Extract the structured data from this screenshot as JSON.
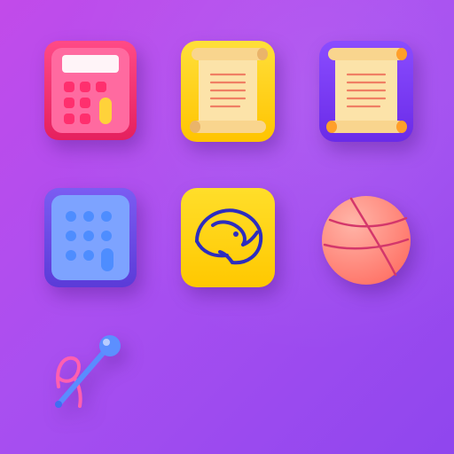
{
  "icons": [
    {
      "id": "calculator-red",
      "name": "calculator-icon",
      "colors": {
        "body": "#ee2e6c",
        "inner": "#ff6aa0",
        "key": "#ff2f6e",
        "accent": "#ffd23a"
      }
    },
    {
      "id": "scroll-yellow",
      "name": "scroll-icon",
      "colors": {
        "tile": "#ffd21f",
        "paper": "#fce3a9",
        "lines": "#f07f64"
      }
    },
    {
      "id": "scroll-purple",
      "name": "scroll-icon",
      "colors": {
        "tile": "#7d3cf5",
        "paper": "#fce3a9",
        "lines": "#f07f64",
        "roll": "#ff9f2a"
      }
    },
    {
      "id": "calculator-blue",
      "name": "calculator-icon",
      "colors": {
        "body": "#6a48e8",
        "inner": "#7da3ff",
        "key": "#4e8dff"
      }
    },
    {
      "id": "rhino-tile",
      "name": "rhino-icon",
      "colors": {
        "tile": "#ffd20f",
        "stroke": "#2d2dbf"
      }
    },
    {
      "id": "ball",
      "name": "basketball-icon",
      "colors": {
        "ball": "#ff8c86",
        "seams": "#d4376b"
      }
    },
    {
      "id": "wand",
      "name": "wand-icon",
      "colors": {
        "stick": "#5a8cff",
        "tip": "#5c8fff",
        "ribbon": "#ff5fb0"
      }
    }
  ]
}
